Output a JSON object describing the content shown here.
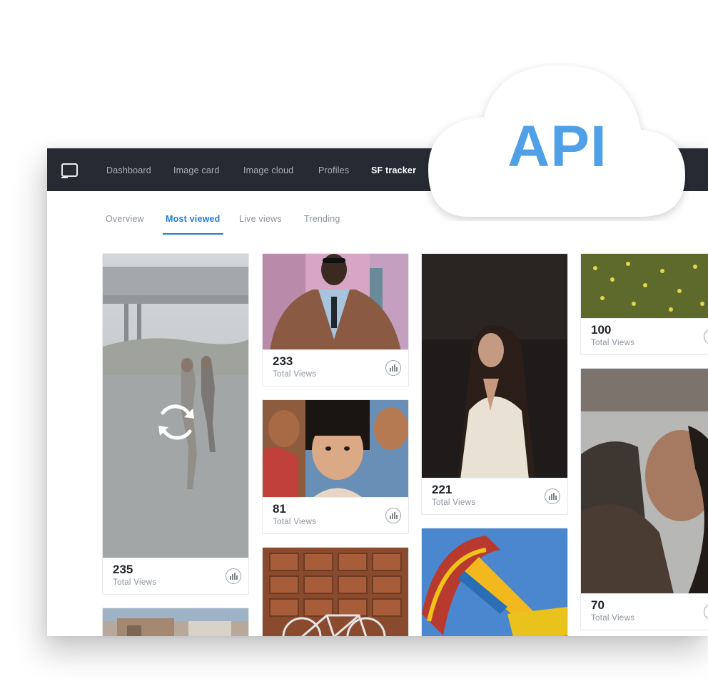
{
  "nav": {
    "items": [
      "Dashboard",
      "Image card",
      "Image cloud",
      "Profiles",
      "SF tracker"
    ],
    "active": "SF tracker"
  },
  "tabs": {
    "items": [
      "Overview",
      "Most viewed",
      "Live views",
      "Trending"
    ],
    "active": "Most viewed"
  },
  "cloud": {
    "label": "API"
  },
  "cards": [
    {
      "views": "235",
      "label": "Total Views",
      "state": "loading"
    },
    {
      "views": "233",
      "label": "Total Views"
    },
    {
      "views": "81",
      "label": "Total Views"
    },
    {
      "views": "221",
      "label": "Total Views"
    },
    {
      "views": "100",
      "label": "Total Views"
    },
    {
      "views": "70",
      "label": "Total Views"
    }
  ],
  "icons": {
    "logo": "monitor-icon",
    "reload": "refresh-icon",
    "stats": "bar-chart-icon"
  },
  "colors": {
    "accent": "#1f7ed2",
    "topbar": "#262b33",
    "cloud_text": "#4fa0e6"
  }
}
